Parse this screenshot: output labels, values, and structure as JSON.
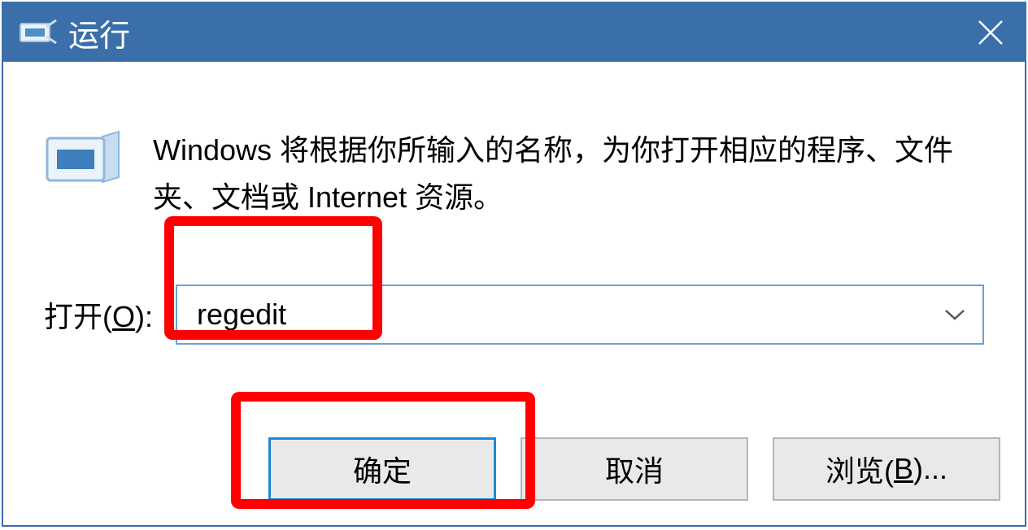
{
  "titlebar": {
    "title": "运行"
  },
  "description": "Windows 将根据你所输入的名称，为你打开相应的程序、文件夹、文档或 Internet 资源。",
  "open": {
    "label_prefix": "打开(",
    "label_key": "O",
    "label_suffix": "):",
    "value": "regedit"
  },
  "buttons": {
    "ok": "确定",
    "cancel": "取消",
    "browse_prefix": "浏览(",
    "browse_key": "B",
    "browse_suffix": ")..."
  }
}
